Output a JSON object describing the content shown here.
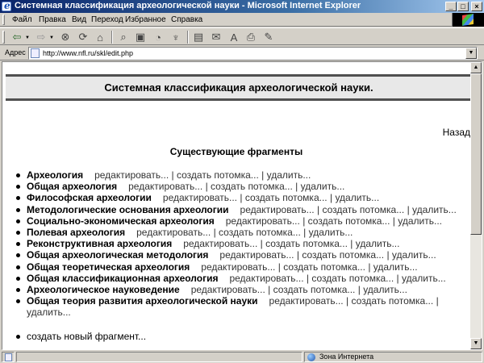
{
  "window": {
    "title": "Системная классификация археологической науки - Microsoft Internet Explorer",
    "controls": [
      "_",
      "□",
      "×"
    ]
  },
  "menu": [
    "Файл",
    "Правка",
    "Вид",
    "Переход",
    "Избранное",
    "Справка"
  ],
  "toolbar_icons": [
    "back-icon",
    "forward-icon",
    "stop-icon",
    "refresh-icon",
    "home-icon",
    "search-icon",
    "favorites-icon",
    "history-icon",
    "channels-icon",
    "fullscreen-icon",
    "mail-icon",
    "font-icon",
    "print-icon",
    "edit-icon"
  ],
  "address": {
    "label": "Адрес",
    "url": "http://www.nfl.ru/skl/edit.php"
  },
  "page": {
    "title": "Системная классификация археологической науки.",
    "back_link": "Назад",
    "subheading": "Существующие фрагменты",
    "actions": {
      "edit": "редактировать...",
      "child": "создать потомка...",
      "delete": "удалить...",
      "separator": "|"
    },
    "fragments": [
      "Археология",
      "Общая археология",
      "Философская археологии",
      "Методологические основания археологии",
      "Социально-экономическая археология",
      "Полевая археология",
      "Реконструктивная археология",
      "Общая археологическая методология",
      "Общая теоретическая археология",
      "Общая классификационная археология",
      "Археологическое науковедение",
      "Общая теория развития археологической науки"
    ],
    "new_fragment": "создать новый фрагмент..."
  },
  "status": {
    "zone": "Зона Интернета"
  }
}
